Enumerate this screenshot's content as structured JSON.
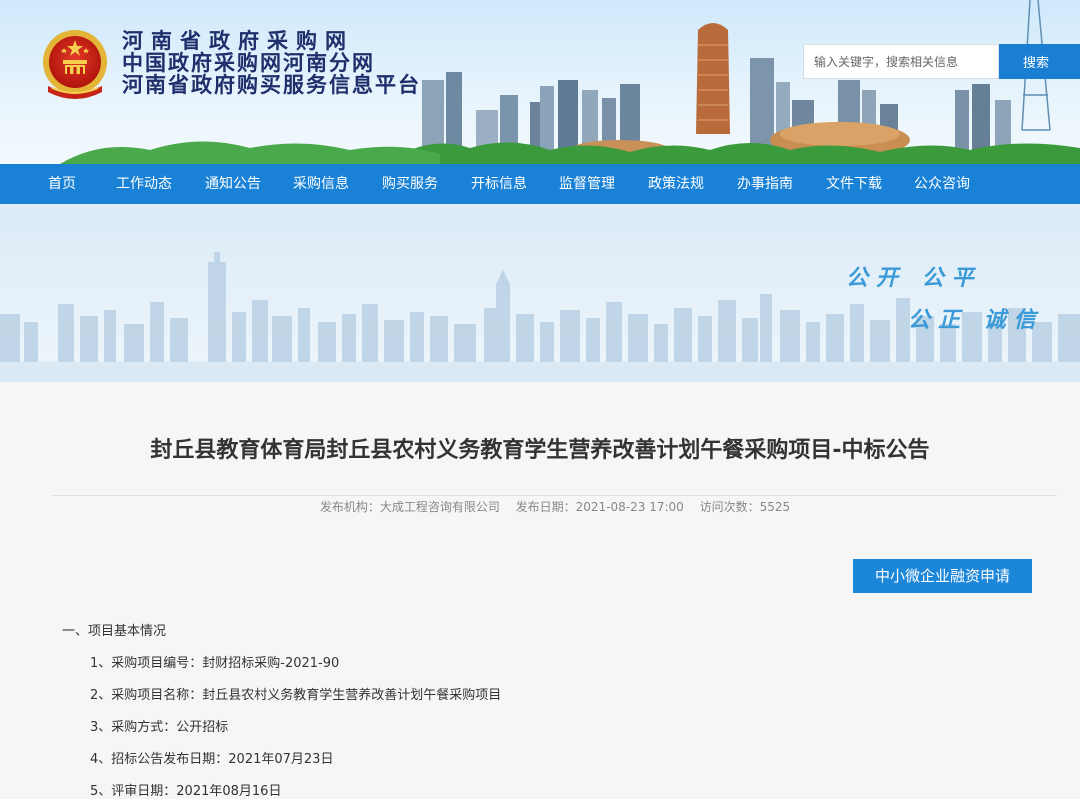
{
  "header": {
    "title_lines": [
      "河南省政府采购网",
      "中国政府采购网河南分网",
      "河南省政府购买服务信息平台"
    ],
    "search": {
      "placeholder": "输入关键字，搜索相关信息",
      "button_label": "搜索"
    }
  },
  "nav": {
    "items": [
      "首页",
      "工作动态",
      "通知公告",
      "采购信息",
      "购买服务",
      "开标信息",
      "监督管理",
      "政策法规",
      "办事指南",
      "文件下载",
      "公众咨询"
    ]
  },
  "banner": {
    "slogan_line1": "公开  公平",
    "slogan_line2": "公正  诚信"
  },
  "article": {
    "title": "封丘县教育体育局封丘县农村义务教育学生营养改善计划午餐采购项目-中标公告",
    "meta": {
      "publisher": "发布机构：大成工程咨询有限公司",
      "date": "发布日期：2021-08-23 17:00",
      "visits": "访问次数：5525"
    },
    "apply_button": "中小微企业融资申请",
    "section_heading": "一、项目基本情况",
    "items": [
      "1、采购项目编号：封财招标采购-2021-90",
      "2、采购项目名称：封丘县农村义务教育学生营养改善计划午餐采购项目",
      "3、采购方式：公开招标",
      "4、招标公告发布日期：2021年07月23日",
      "5、评审日期：2021年08月16日"
    ]
  },
  "colors": {
    "nav_blue": "#1a82d6",
    "title_navy": "#1f2f6b",
    "button_blue": "#1c86d9",
    "slogan_blue": "#3c9ad8"
  },
  "icons": {
    "emblem": "national-emblem-icon"
  }
}
